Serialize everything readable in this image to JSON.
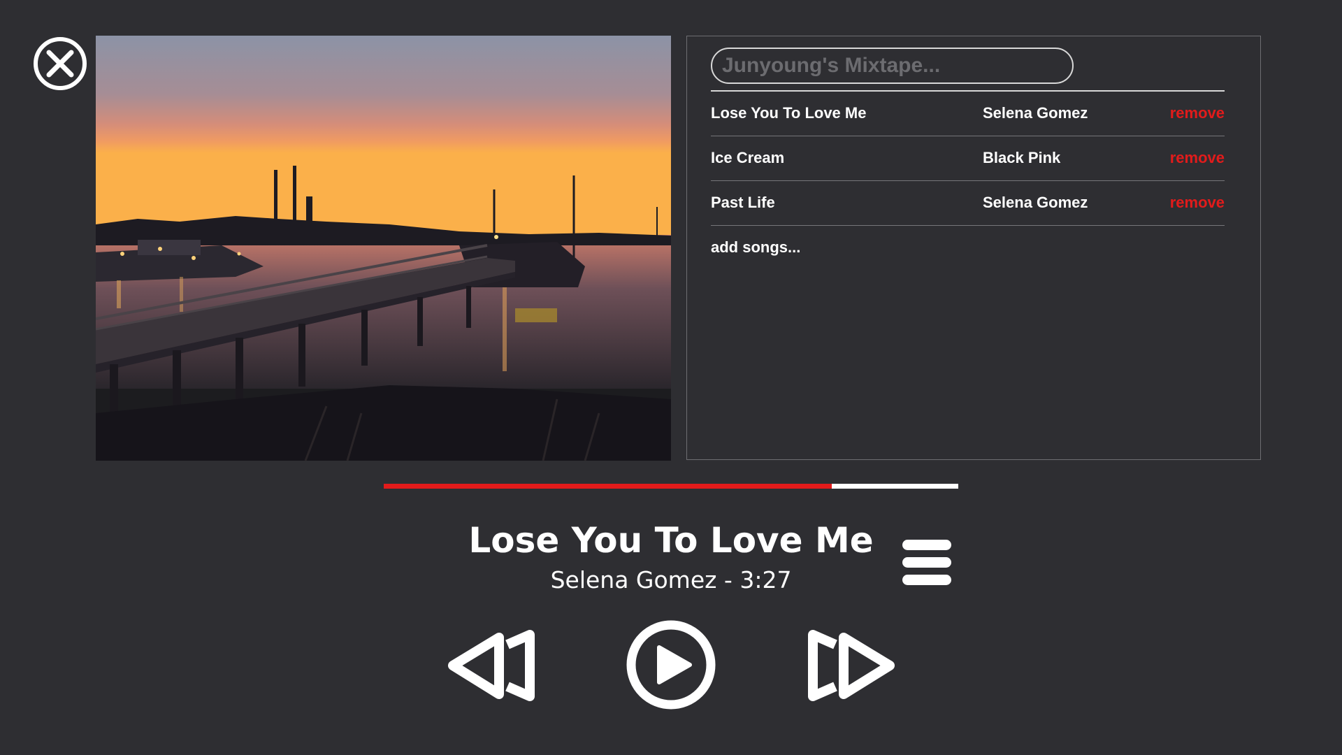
{
  "playlist": {
    "title_value": "",
    "title_placeholder": "Junyoung's Mixtape...",
    "songs": [
      {
        "title": "Lose You To Love Me",
        "artist": "Selena Gomez",
        "action": "remove"
      },
      {
        "title": "Ice Cream",
        "artist": "Black Pink",
        "action": "remove"
      },
      {
        "title": "Past Life",
        "artist": "Selena Gomez",
        "action": "remove"
      }
    ],
    "add_label": "add songs..."
  },
  "now_playing": {
    "title": "Lose You To Love Me",
    "subtitle": "Selena Gomez -  3:27",
    "progress": 0.78
  },
  "icons": {
    "close": "close-circle-icon",
    "menu": "hamburger-menu-icon",
    "previous": "previous-track-icon",
    "play": "play-icon",
    "next": "next-track-icon"
  },
  "colors": {
    "background": "#2e2e32",
    "accent": "#e21b1b",
    "text": "#ffffff",
    "placeholder": "#6c6c70"
  }
}
